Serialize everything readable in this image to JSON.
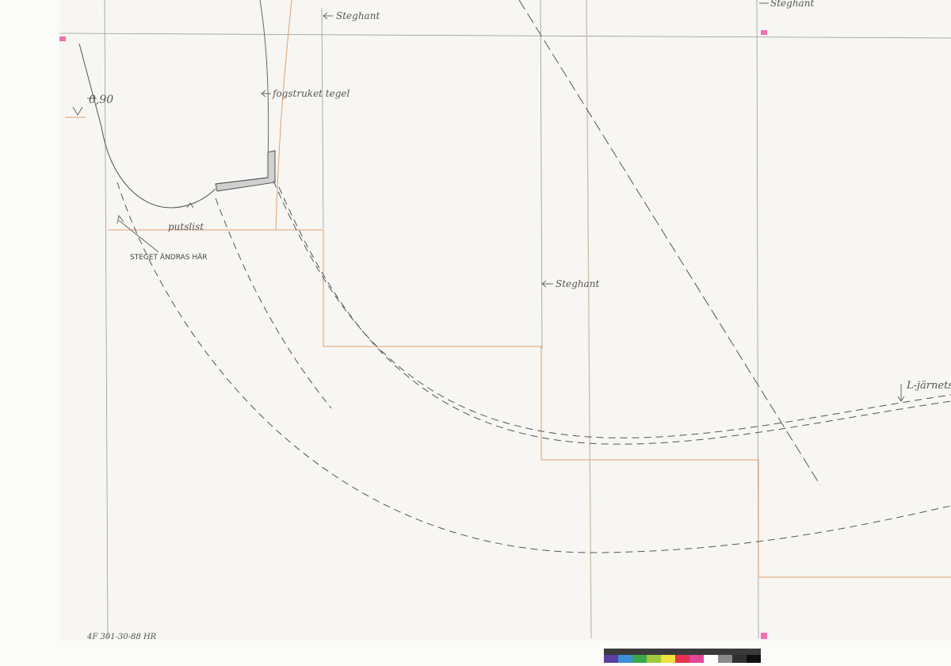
{
  "labels": {
    "steghant_top": "Steghant",
    "steghant_top_right": "Steghant",
    "dim_value": "0,90",
    "fogstruket_tegel": "fogstruket tegel",
    "putslist": "putslist",
    "steget_andras": "STEGET ÄNDRAS HÄR",
    "steghant_middle": "Steghant",
    "l_jarnets": "L-järnets",
    "catalog_number": "4F 301-30-88 HR"
  },
  "colors": {
    "paper": "#f7f6f3",
    "pencil": "#777777",
    "orange_pencil": "#e0a070",
    "ink": "#333333",
    "register_mark": "#f070b0"
  },
  "color_bar": {
    "swatches": [
      "#5a3fa0",
      "#3a8fd8",
      "#3aa84a",
      "#a0c83a",
      "#f0e040",
      "#e83050",
      "#e04898",
      "#ffffff",
      "#8a8a8a",
      "#303030",
      "#101010"
    ]
  }
}
